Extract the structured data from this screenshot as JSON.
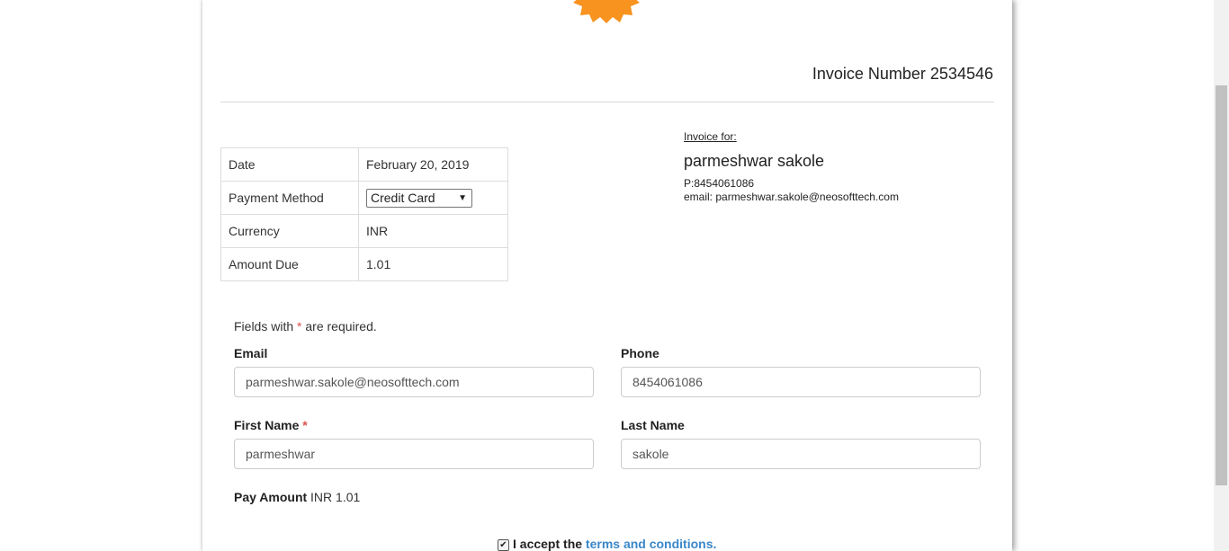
{
  "invoice": {
    "number_label": "Invoice Number 2534546"
  },
  "details": [
    {
      "label": "Date",
      "value": "February 20, 2019"
    },
    {
      "label": "Payment Method",
      "value": "Credit Card"
    },
    {
      "label": "Currency",
      "value": "INR"
    },
    {
      "label": "Amount Due",
      "value": "1.01"
    }
  ],
  "invoice_for": {
    "label": "Invoice for:",
    "name": "parmeshwar sakole",
    "phone": "P:8454061086",
    "email": "email: parmeshwar.sakole@neosofttech.com"
  },
  "form": {
    "required_prefix": "Fields with ",
    "required_star": "*",
    "required_suffix": " are required.",
    "email_label": "Email",
    "email_value": "parmeshwar.sakole@neosofttech.com",
    "phone_label": "Phone",
    "phone_value": "8454061086",
    "first_name_label": "First Name",
    "first_name_value": "parmeshwar",
    "last_name_label": "Last Name",
    "last_name_value": "sakole",
    "pay_amount_label": "Pay Amount",
    "pay_amount_value": "INR 1.01",
    "terms_prefix": "I accept the ",
    "terms_link": "terms and conditions.",
    "terms_checked": true
  },
  "colors": {
    "logo_orange": "#f7931e",
    "link_blue": "#3a87c9",
    "required_red": "#d9534f"
  },
  "icons": {
    "logo": "orange-gear-badge",
    "select_arrow": "triangle-down",
    "checkbox": "check-mark"
  }
}
